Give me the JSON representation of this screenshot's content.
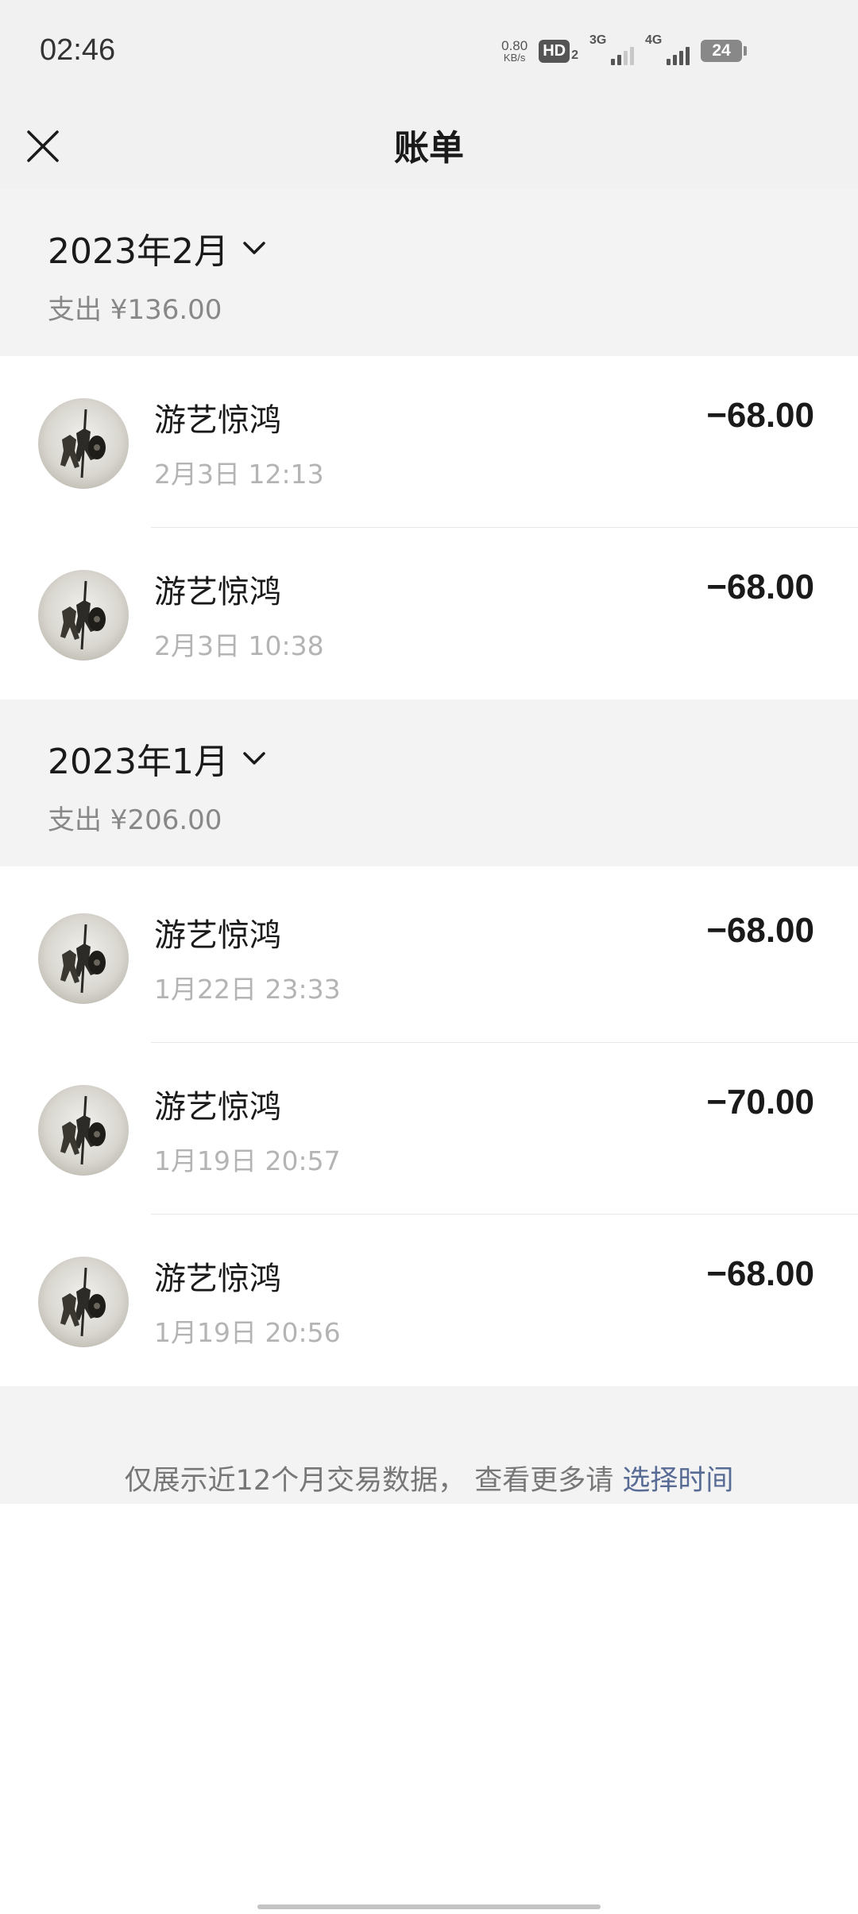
{
  "status_bar": {
    "time": "02:46",
    "net_speed_value": "0.80",
    "net_speed_unit": "KB/s",
    "hd_label": "HD",
    "hd_sim": "2",
    "sig1_label": "3G",
    "sig2_label": "4G",
    "battery": "24"
  },
  "nav": {
    "title": "账单",
    "close_icon": "close-icon"
  },
  "months": [
    {
      "label": "2023年2月",
      "summary": "支出 ¥136.00",
      "transactions": [
        {
          "name": "游艺惊鸿",
          "time": "2月3日 12:13",
          "amount": "−68.00"
        },
        {
          "name": "游艺惊鸿",
          "time": "2月3日 10:38",
          "amount": "−68.00"
        }
      ]
    },
    {
      "label": "2023年1月",
      "summary": "支出 ¥206.00",
      "transactions": [
        {
          "name": "游艺惊鸿",
          "time": "1月22日 23:33",
          "amount": "−68.00"
        },
        {
          "name": "游艺惊鸿",
          "time": "1月19日 20:57",
          "amount": "−70.00"
        },
        {
          "name": "游艺惊鸿",
          "time": "1月19日 20:56",
          "amount": "−68.00"
        }
      ]
    }
  ],
  "footer": {
    "text": "仅展示近12个月交易数据， 查看更多请 ",
    "link": "选择时间"
  },
  "colors": {
    "link": "#576b95",
    "section_bg": "#f3f3f3",
    "muted_text": "#b4b4b4"
  }
}
